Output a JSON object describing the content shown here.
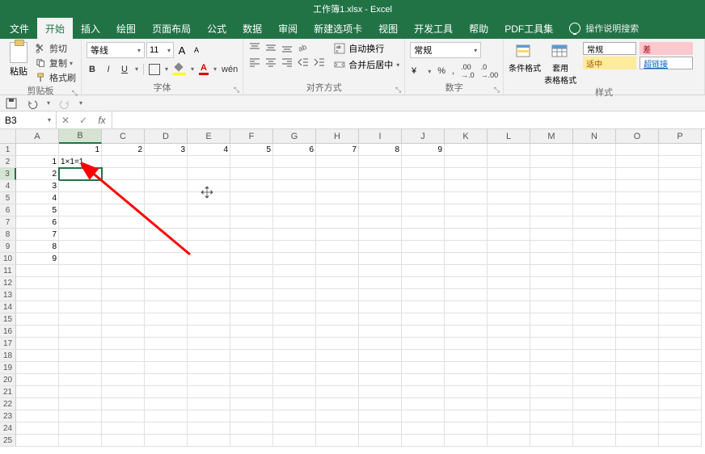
{
  "titlebar": {
    "title": "工作簿1.xlsx - Excel"
  },
  "tabs": {
    "items": [
      "文件",
      "开始",
      "插入",
      "绘图",
      "页面布局",
      "公式",
      "数据",
      "审阅",
      "新建选项卡",
      "视图",
      "开发工具",
      "帮助",
      "PDF工具集"
    ],
    "active": 1,
    "tellme": "操作说明搜索"
  },
  "ribbon": {
    "clipboard": {
      "paste": "粘贴",
      "cut": "剪切",
      "copy": "复制",
      "format_painter": "格式刷",
      "label": "剪贴板"
    },
    "font": {
      "name": "等线",
      "size": "11",
      "label": "字体",
      "bold": "B",
      "italic": "I",
      "underline": "U",
      "color_letter": "A"
    },
    "align": {
      "wrap": "自动换行",
      "merge": "合并后居中",
      "label": "对齐方式"
    },
    "number": {
      "format": "常规",
      "label": "数字"
    },
    "styles": {
      "cond": "条件格式",
      "table": "套用\n表格格式",
      "normal": "常规",
      "bad": "差",
      "neutral": "适中",
      "link": "超链接",
      "label": "样式"
    }
  },
  "fbar": {
    "namebox": "B3",
    "formula": ""
  },
  "grid": {
    "cols": [
      "A",
      "B",
      "C",
      "D",
      "E",
      "F",
      "G",
      "H",
      "I",
      "J",
      "K",
      "L",
      "M",
      "N",
      "O",
      "P"
    ],
    "rowcount": 25,
    "selected_col": "B",
    "selected_row": 3,
    "data_A": [
      "1",
      "2",
      "3",
      "4",
      "5",
      "6",
      "7",
      "8",
      "9"
    ],
    "data_row1": [
      "1",
      "2",
      "3",
      "4",
      "5",
      "6",
      "7",
      "8",
      "9"
    ],
    "b2": "1×1=1"
  }
}
